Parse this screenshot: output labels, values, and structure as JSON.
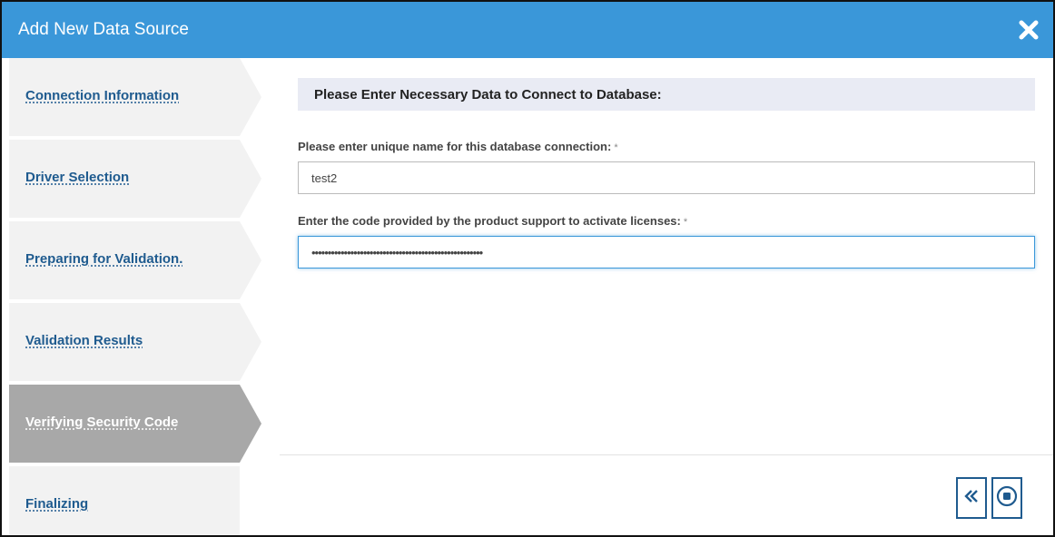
{
  "dialog": {
    "title": "Add New Data Source",
    "close_icon": "close-icon",
    "accent_color": "#3a97d9"
  },
  "steps": [
    {
      "label": "Connection Information",
      "active": false
    },
    {
      "label": "Driver Selection",
      "active": false
    },
    {
      "label": "Preparing for Validation.",
      "active": false
    },
    {
      "label": "Validation Results",
      "active": false
    },
    {
      "label": "Verifying Security Code",
      "active": true
    },
    {
      "label": "Finalizing",
      "active": false
    }
  ],
  "main": {
    "section_title": "Please Enter Necessary Data to Connect to Database:",
    "name_field": {
      "label": "Please enter unique name for this database connection:",
      "required_mark": "*",
      "value": "test2"
    },
    "code_field": {
      "label": "Enter the code provided by the product support to activate licenses:",
      "required_mark": "*",
      "value": "•••••••••••••••••••••••••••••••••••••••••••••••••••••"
    }
  },
  "buttons": {
    "back_icon": "double-chevron-left-icon",
    "stop_icon": "stop-circle-icon"
  }
}
